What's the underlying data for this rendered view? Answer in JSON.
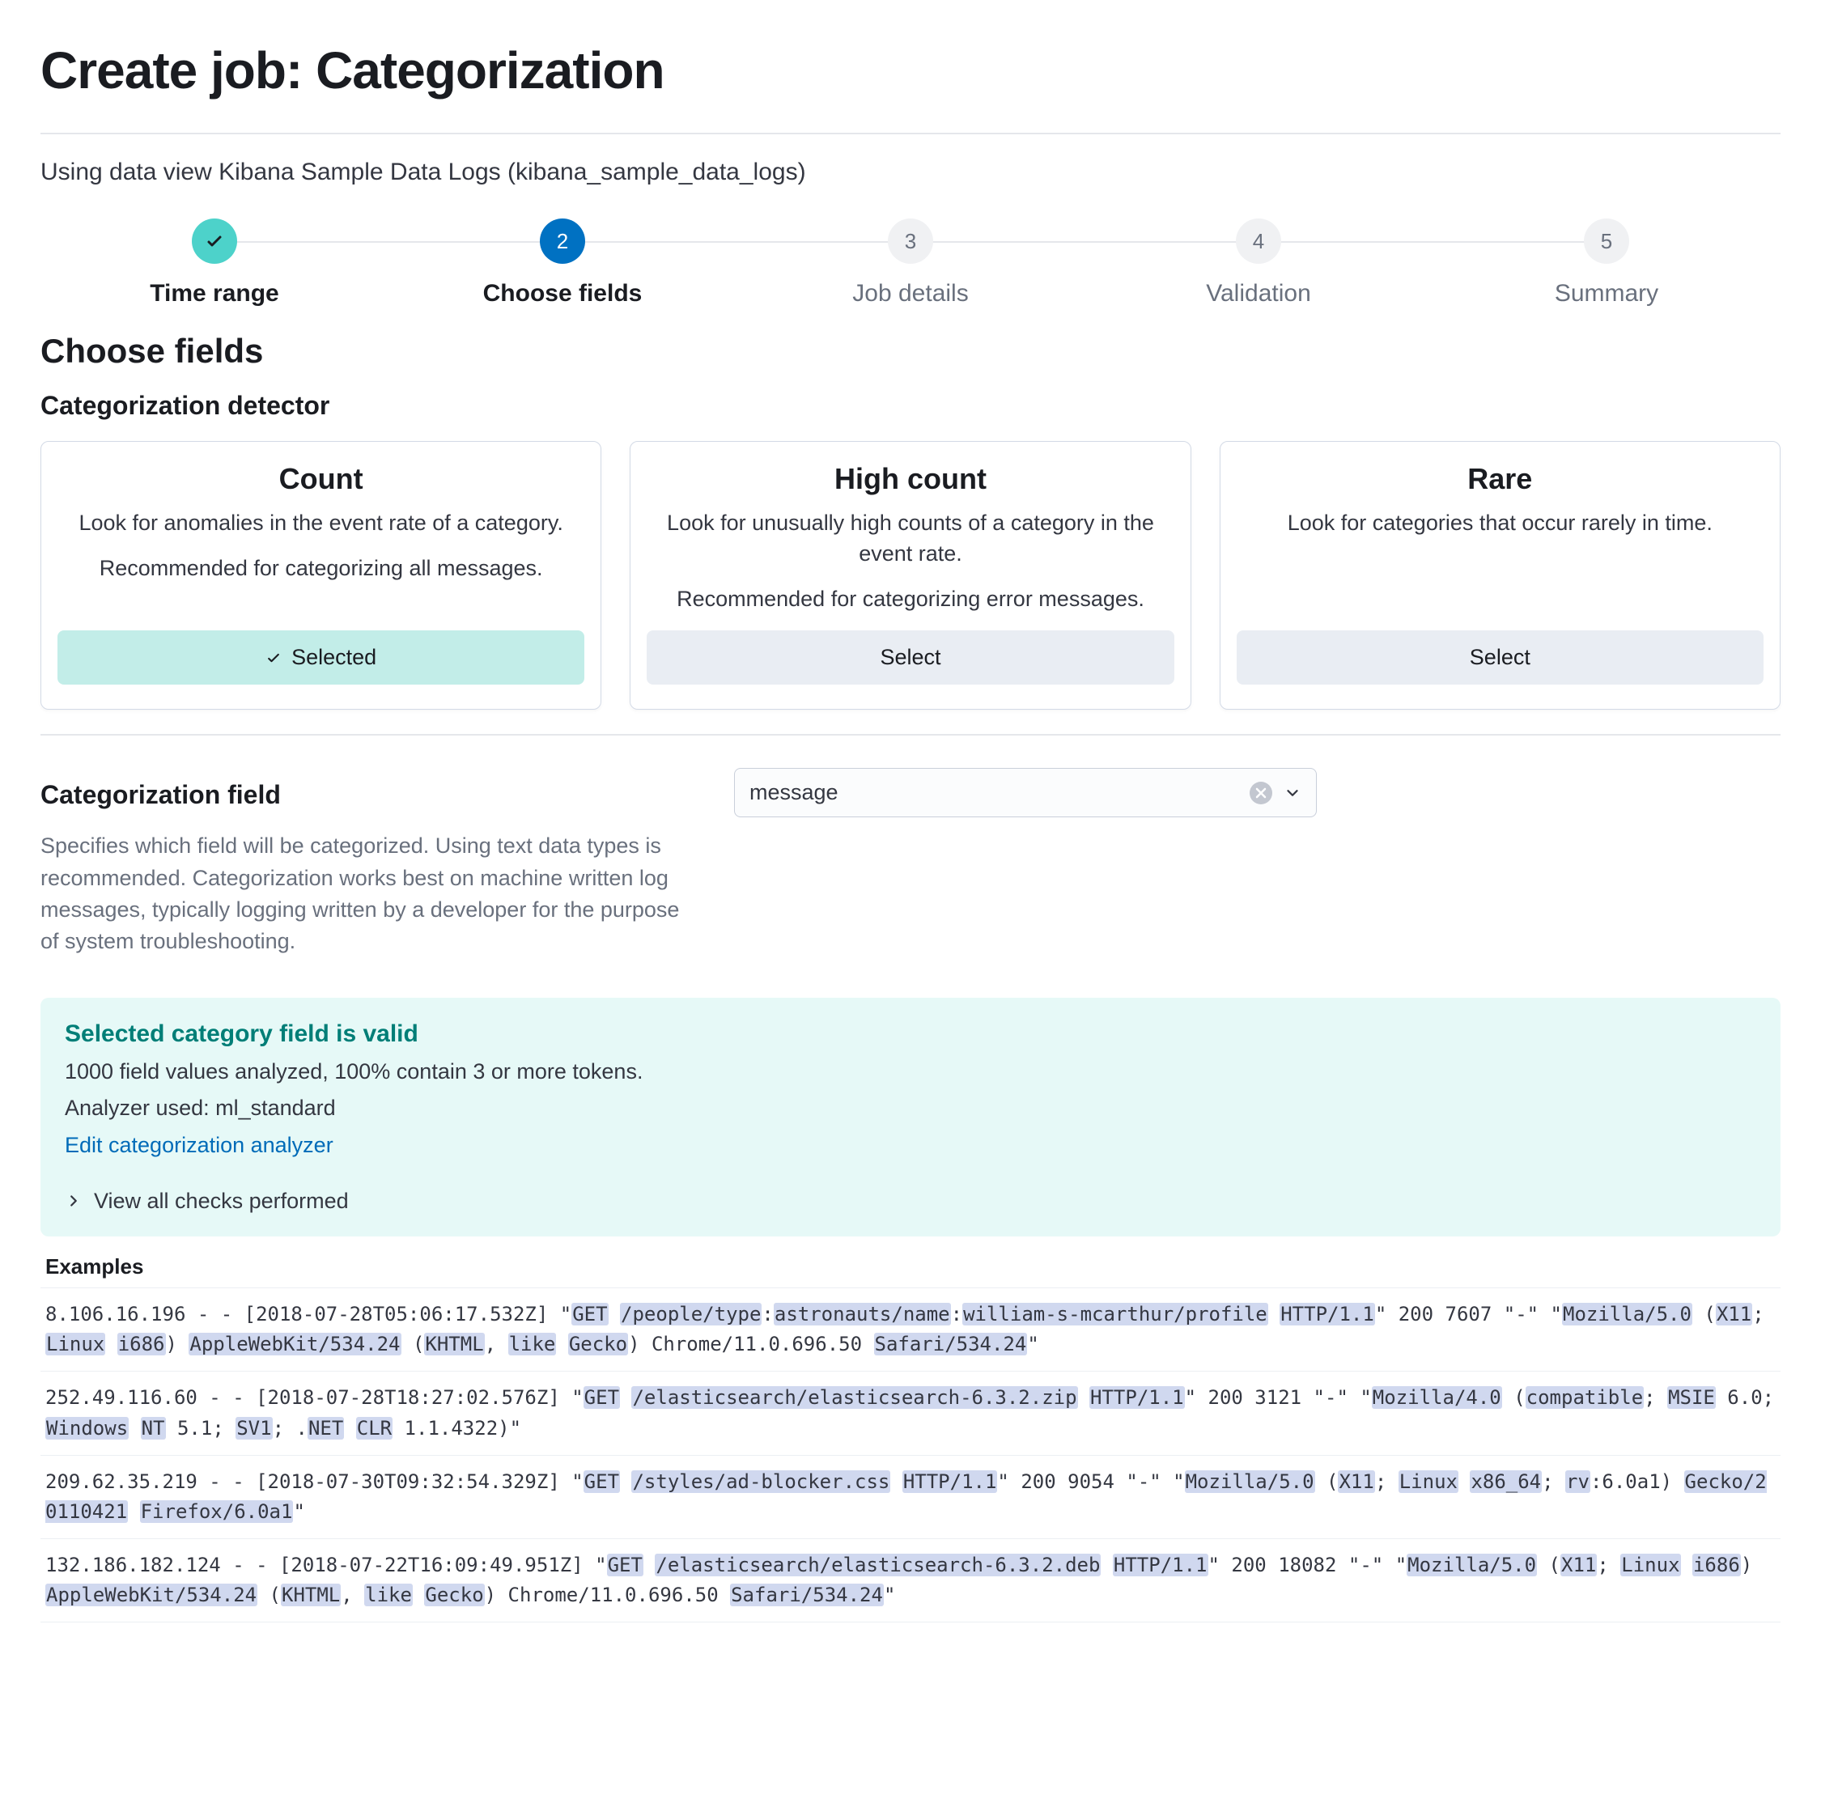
{
  "page": {
    "title": "Create job: Categorization",
    "data_view": "Using data view Kibana Sample Data Logs (kibana_sample_data_logs)"
  },
  "stepper": {
    "steps": [
      {
        "label": "Time range",
        "state": "done",
        "num": "✓"
      },
      {
        "label": "Choose fields",
        "state": "active",
        "num": "2"
      },
      {
        "label": "Job details",
        "state": "inactive",
        "num": "3"
      },
      {
        "label": "Validation",
        "state": "inactive",
        "num": "4"
      },
      {
        "label": "Summary",
        "state": "inactive",
        "num": "5"
      }
    ]
  },
  "section": {
    "choose_fields": "Choose fields",
    "detector_heading": "Categorization detector",
    "field_heading": "Categorization field",
    "field_desc": "Specifies which field will be categorized. Using text data types is recommended. Categorization works best on machine written log messages, typically logging written by a developer for the purpose of system troubleshooting.",
    "examples_heading": "Examples"
  },
  "detectors": [
    {
      "title": "Count",
      "desc": "Look for anomalies in the event rate of a category.",
      "rec": "Recommended for categorizing all messages.",
      "selected": true,
      "button": "Selected"
    },
    {
      "title": "High count",
      "desc": "Look for unusually high counts of a category in the event rate.",
      "rec": "Recommended for categorizing error messages.",
      "selected": false,
      "button": "Select"
    },
    {
      "title": "Rare",
      "desc": "Look for categories that occur rarely in time.",
      "rec": "",
      "selected": false,
      "button": "Select"
    }
  ],
  "field": {
    "value": "message"
  },
  "callout": {
    "title": "Selected category field is valid",
    "line1": "1000 field values analyzed, 100% contain 3 or more tokens.",
    "line2": "Analyzer used: ml_standard",
    "link": "Edit categorization analyzer",
    "expand": "View all checks performed"
  },
  "examples": [
    {
      "tokens": [
        {
          "t": "8.106.16.196 - - [2018-07-28T05:06:17.532Z] \"",
          "h": false
        },
        {
          "t": "GET",
          "h": true
        },
        {
          "t": " ",
          "h": false
        },
        {
          "t": "/people/type",
          "h": true
        },
        {
          "t": ":",
          "h": false
        },
        {
          "t": "astronauts/name",
          "h": true
        },
        {
          "t": ":",
          "h": false
        },
        {
          "t": "william-s-mcarthur/profile",
          "h": true
        },
        {
          "t": " ",
          "h": false
        },
        {
          "t": "HTTP/1.1",
          "h": true
        },
        {
          "t": "\" 200 7607 \"-\" \"",
          "h": false
        },
        {
          "t": "Mozilla/5.0",
          "h": true
        },
        {
          "t": " (",
          "h": false
        },
        {
          "t": "X11",
          "h": true
        },
        {
          "t": "; ",
          "h": false
        },
        {
          "t": "Linux",
          "h": true
        },
        {
          "t": " ",
          "h": false
        },
        {
          "t": "i686",
          "h": true
        },
        {
          "t": ") ",
          "h": false
        },
        {
          "t": "AppleWebKit/534.24",
          "h": true
        },
        {
          "t": " (",
          "h": false
        },
        {
          "t": "KHTML",
          "h": true
        },
        {
          "t": ", ",
          "h": false
        },
        {
          "t": "like",
          "h": true
        },
        {
          "t": " ",
          "h": false
        },
        {
          "t": "Gecko",
          "h": true
        },
        {
          "t": ") Chrome/11.0.696.50 ",
          "h": false
        },
        {
          "t": "Safari/534.24",
          "h": true
        },
        {
          "t": "\"",
          "h": false
        }
      ]
    },
    {
      "tokens": [
        {
          "t": "252.49.116.60 - - [2018-07-28T18:27:02.576Z] \"",
          "h": false
        },
        {
          "t": "GET",
          "h": true
        },
        {
          "t": " ",
          "h": false
        },
        {
          "t": "/elasticsearch/elasticsearch-6.3.2.zip",
          "h": true
        },
        {
          "t": " ",
          "h": false
        },
        {
          "t": "HTTP/1.1",
          "h": true
        },
        {
          "t": "\" 200 3121 \"-\" \"",
          "h": false
        },
        {
          "t": "Mozilla/4.0",
          "h": true
        },
        {
          "t": " (",
          "h": false
        },
        {
          "t": "compatible",
          "h": true
        },
        {
          "t": "; ",
          "h": false
        },
        {
          "t": "MSIE",
          "h": true
        },
        {
          "t": " 6.0; ",
          "h": false
        },
        {
          "t": "Windows",
          "h": true
        },
        {
          "t": " ",
          "h": false
        },
        {
          "t": "NT",
          "h": true
        },
        {
          "t": " 5.1; ",
          "h": false
        },
        {
          "t": "SV1",
          "h": true
        },
        {
          "t": "; .",
          "h": false
        },
        {
          "t": "NET",
          "h": true
        },
        {
          "t": " ",
          "h": false
        },
        {
          "t": "CLR",
          "h": true
        },
        {
          "t": " 1.1.4322)\"",
          "h": false
        }
      ]
    },
    {
      "tokens": [
        {
          "t": "209.62.35.219 - - [2018-07-30T09:32:54.329Z] \"",
          "h": false
        },
        {
          "t": "GET",
          "h": true
        },
        {
          "t": " ",
          "h": false
        },
        {
          "t": "/styles/ad-blocker.css",
          "h": true
        },
        {
          "t": " ",
          "h": false
        },
        {
          "t": "HTTP/1.1",
          "h": true
        },
        {
          "t": "\" 200 9054 \"-\" \"",
          "h": false
        },
        {
          "t": "Mozilla/5.0",
          "h": true
        },
        {
          "t": " (",
          "h": false
        },
        {
          "t": "X11",
          "h": true
        },
        {
          "t": "; ",
          "h": false
        },
        {
          "t": "Linux",
          "h": true
        },
        {
          "t": " ",
          "h": false
        },
        {
          "t": "x86_64",
          "h": true
        },
        {
          "t": "; ",
          "h": false
        },
        {
          "t": "rv",
          "h": true
        },
        {
          "t": ":6.0a1) ",
          "h": false
        },
        {
          "t": "Gecko/20110421",
          "h": true
        },
        {
          "t": " ",
          "h": false
        },
        {
          "t": "Firefox/6.0a1",
          "h": true
        },
        {
          "t": "\"",
          "h": false
        }
      ]
    },
    {
      "tokens": [
        {
          "t": "132.186.182.124 - - [2018-07-22T16:09:49.951Z] \"",
          "h": false
        },
        {
          "t": "GET",
          "h": true
        },
        {
          "t": " ",
          "h": false
        },
        {
          "t": "/elasticsearch/elasticsearch-6.3.2.deb",
          "h": true
        },
        {
          "t": " ",
          "h": false
        },
        {
          "t": "HTTP/1.1",
          "h": true
        },
        {
          "t": "\" 200 18082 \"-\" \"",
          "h": false
        },
        {
          "t": "Mozilla/5.0",
          "h": true
        },
        {
          "t": " (",
          "h": false
        },
        {
          "t": "X11",
          "h": true
        },
        {
          "t": "; ",
          "h": false
        },
        {
          "t": "Linux",
          "h": true
        },
        {
          "t": " ",
          "h": false
        },
        {
          "t": "i686",
          "h": true
        },
        {
          "t": ") ",
          "h": false
        },
        {
          "t": "AppleWebKit/534.24",
          "h": true
        },
        {
          "t": " (",
          "h": false
        },
        {
          "t": "KHTML",
          "h": true
        },
        {
          "t": ", ",
          "h": false
        },
        {
          "t": "like",
          "h": true
        },
        {
          "t": " ",
          "h": false
        },
        {
          "t": "Gecko",
          "h": true
        },
        {
          "t": ") Chrome/11.0.696.50 ",
          "h": false
        },
        {
          "t": "Safari/534.24",
          "h": true
        },
        {
          "t": "\"",
          "h": false
        }
      ]
    }
  ]
}
